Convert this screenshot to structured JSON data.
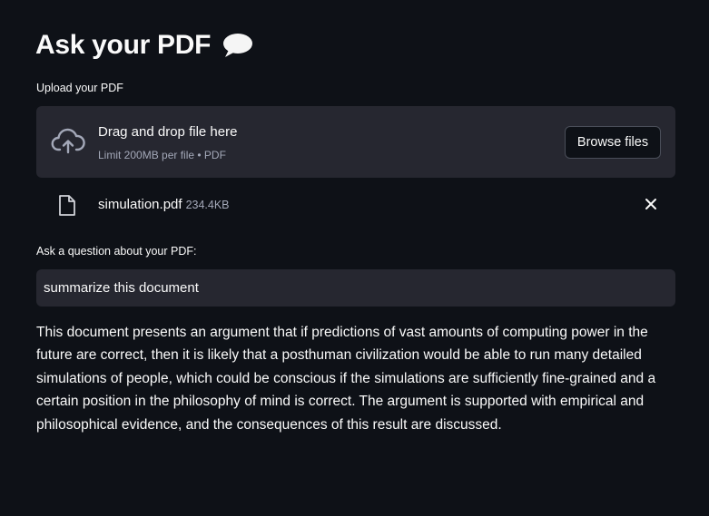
{
  "header": {
    "title": "Ask your PDF",
    "title_icon": "speech-bubble-icon"
  },
  "uploader": {
    "label": "Upload your PDF",
    "drop_title": "Drag and drop file here",
    "limit_text": "Limit 200MB per file • PDF",
    "browse_label": "Browse files",
    "icon": "cloud-upload-icon"
  },
  "uploaded_file": {
    "name": "simulation.pdf",
    "size": "234.4KB",
    "icon": "file-icon",
    "remove_icon": "close-icon"
  },
  "question": {
    "label": "Ask a question about your PDF:",
    "value": "summarize this document"
  },
  "answer": {
    "text": "This document presents an argument that if predictions of vast amounts of computing power in the future are correct, then it is likely that a posthuman civilization would be able to run many detailed simulations of people, which could be conscious if the simulations are sufficiently fine-grained and a certain position in the philosophy of mind is correct. The argument is supported with empirical and philosophical evidence, and the consequences of this result are discussed."
  },
  "colors": {
    "background": "#0e1117",
    "panel": "#262730",
    "text": "#fafafa",
    "muted": "#a3a8b8"
  }
}
